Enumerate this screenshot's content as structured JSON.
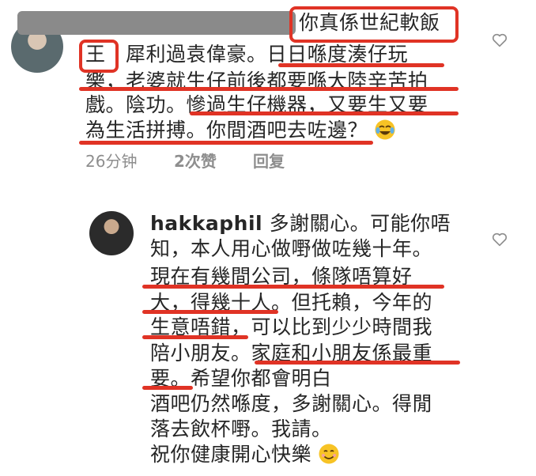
{
  "comment1": {
    "name_tail": "你真係世紀軟飯",
    "lines": [
      "王　犀利過袁偉豪。日日喺度湊仔玩",
      "樂，老婆就生仔前後都要喺大陸辛苦拍",
      "戲。陰功。慘過生仔機器，又要生又要",
      "為生活拼搏。你間酒吧去咗邊？"
    ],
    "emoji": "tears-of-joy-emoji",
    "meta": {
      "time": "26分钟",
      "likes": "2次赞",
      "reply": "回复"
    }
  },
  "comment2": {
    "username": "hakkaphil",
    "first_line": "多謝關心。可能你唔",
    "lines": [
      "知，本人用心做嘢做咗幾十年。",
      "現在有幾間公司，條隊唔算好",
      "大，得幾十人。但托賴，今年的",
      "生意唔錯，可以比到少少時間我",
      "陪小朋友。家庭和小朋友係最重",
      "要。希望你都會明白",
      "酒吧仍然喺度，多謝關心。得閒",
      "落去飲杯嘢。我請。",
      "祝你健康開心快樂"
    ],
    "emoji": "smiling-face-emoji"
  },
  "colors": {
    "annotation_red": "#e03325",
    "meta_gray": "#8e8e8e",
    "text": "#262626"
  }
}
